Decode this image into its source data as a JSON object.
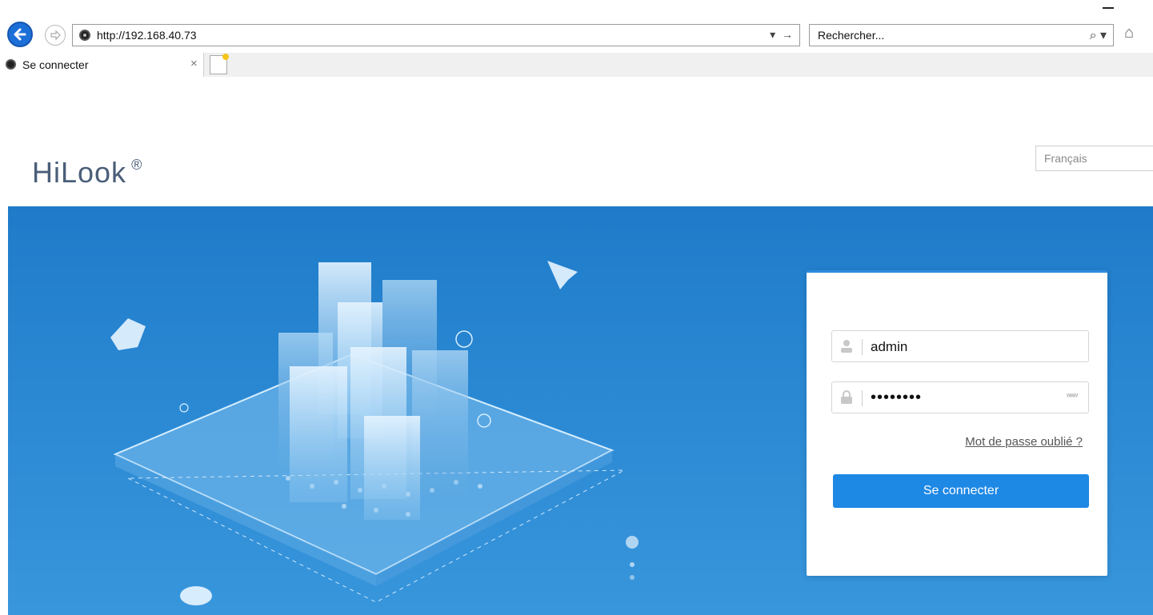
{
  "browser": {
    "url": "http://192.168.40.73",
    "address_arrows": "▾ →",
    "search_placeholder": "Rechercher...",
    "search_icon": "⌕ ▾",
    "tab_title": "Se connecter",
    "tab_close": "×",
    "icons": [
      "back-icon",
      "forward-icon",
      "globe-icon",
      "search-icon",
      "home-icon",
      "new-tab-icon"
    ]
  },
  "header": {
    "logo": "HiLook",
    "logo_mark": "®",
    "language": "Français"
  },
  "login": {
    "username": "admin",
    "password_mask": "••••••••",
    "show_password_icon": "ʷʷʷ",
    "forgot_link": "Mot de passe oublié ?",
    "submit_label": "Se connecter"
  },
  "colors": {
    "accent": "#1e88e5",
    "hero_top": "#1f7bc9",
    "hero_bottom": "#3896dc",
    "logo": "#4a5e78"
  }
}
